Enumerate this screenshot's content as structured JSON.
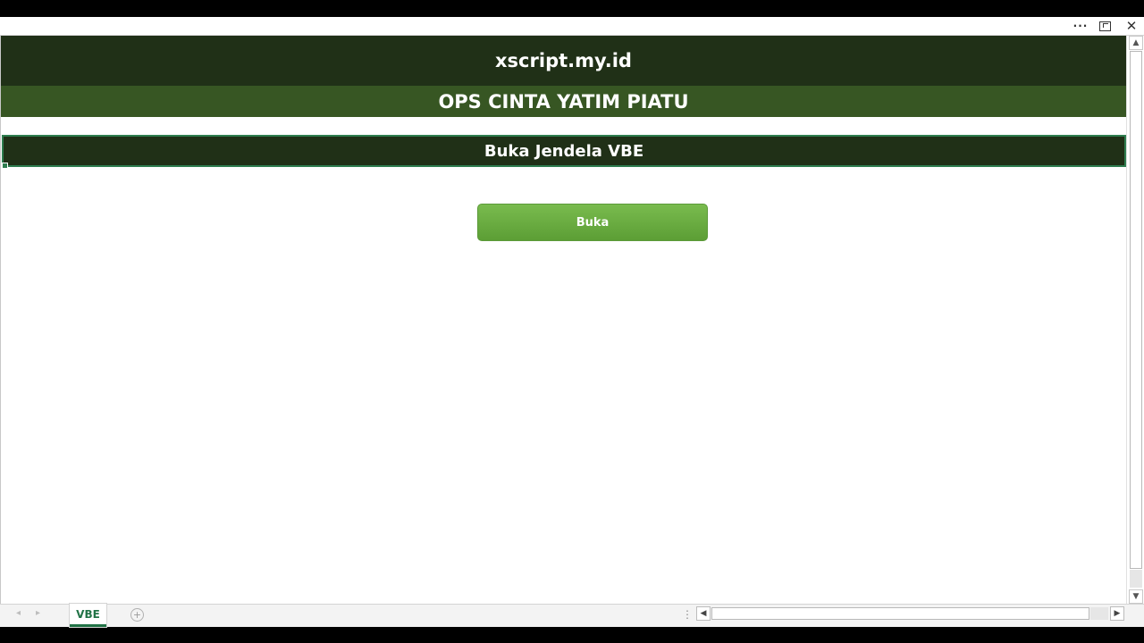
{
  "titlebar": {
    "more_glyph": "···",
    "restore_label": "",
    "close_glyph": "✕"
  },
  "sheet": {
    "site_title": "xscript.my.id",
    "subtitle": "OPS CINTA YATIM PIATU",
    "section_heading": "Buka Jendela VBE",
    "open_button_label": "Buka"
  },
  "colors": {
    "dark_green": "#203017",
    "mid_green": "#375623",
    "button_green": "#6aad42",
    "excel_green": "#217346"
  },
  "tabs": [
    {
      "label": "VBE",
      "active": true
    }
  ],
  "icons": {
    "nav_prev": "◂",
    "nav_next": "▸",
    "add_sheet": "+",
    "split": "⋮",
    "scroll_up": "▲",
    "scroll_down": "▼",
    "scroll_left": "◀",
    "scroll_right": "▶"
  }
}
